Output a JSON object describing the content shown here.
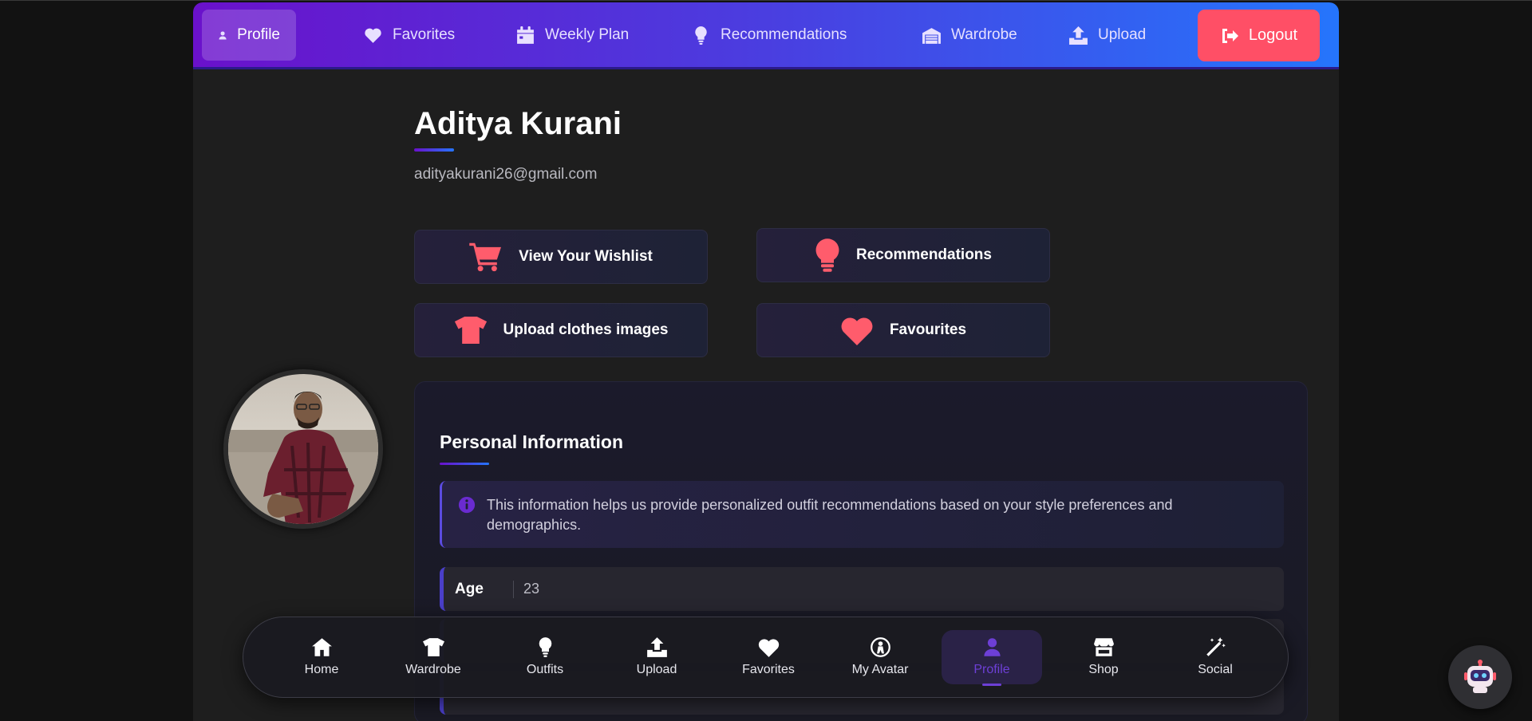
{
  "nav": {
    "items": [
      {
        "label": "Profile",
        "icon": "user-icon"
      },
      {
        "label": "Favorites",
        "icon": "heart-icon"
      },
      {
        "label": "Weekly Plan",
        "icon": "calendar-icon"
      },
      {
        "label": "Recommendations",
        "icon": "lightbulb-icon"
      },
      {
        "label": "Wardrobe",
        "icon": "wardrobe-icon"
      },
      {
        "label": "Upload",
        "icon": "upload-icon"
      }
    ],
    "active": "Profile",
    "logout_label": "Logout"
  },
  "profile": {
    "name": "Aditya Kurani",
    "email": "adityakurani26@gmail.com"
  },
  "actions": [
    {
      "label": "View Your Wishlist",
      "icon": "cart-icon"
    },
    {
      "label": "Recommendations",
      "icon": "lightbulb-icon"
    },
    {
      "label": "Upload clothes images",
      "icon": "tshirt-icon"
    },
    {
      "label": "Favourites",
      "icon": "heart-icon"
    }
  ],
  "personal_info": {
    "title": "Personal Information",
    "notice": "This information helps us provide personalized outfit recommendations based on your style preferences and demographics.",
    "fields": [
      {
        "label": "Age",
        "value": "23"
      }
    ]
  },
  "bottom_nav": {
    "items": [
      {
        "label": "Home",
        "icon": "home-icon"
      },
      {
        "label": "Wardrobe",
        "icon": "tshirt-icon"
      },
      {
        "label": "Outfits",
        "icon": "lightbulb-icon"
      },
      {
        "label": "Upload",
        "icon": "upload-icon"
      },
      {
        "label": "Favorites",
        "icon": "heart-icon"
      },
      {
        "label": "My Avatar",
        "icon": "avatar-icon"
      },
      {
        "label": "Profile",
        "icon": "user-icon"
      },
      {
        "label": "Shop",
        "icon": "store-icon"
      },
      {
        "label": "Social",
        "icon": "magic-wand-icon"
      }
    ],
    "active": "Profile"
  },
  "colors": {
    "nav_gradient_start": "#6a11cb",
    "nav_gradient_end": "#2575fc",
    "logout": "#ff4f66",
    "action_icon": "#ff5c6c",
    "active_bottom": "#6d3fd6"
  }
}
